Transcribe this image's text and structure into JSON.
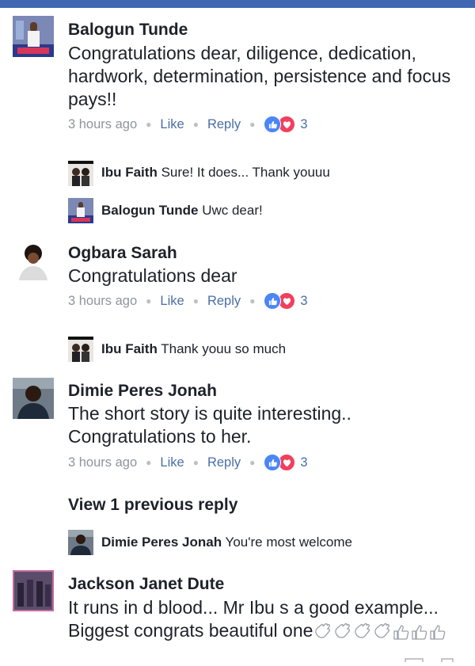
{
  "comments": [
    {
      "author": "Balogun Tunde",
      "text": "Congratulations dear, diligence, dedication, hardwork, determination, persistence and focus pays!!",
      "time": "3 hours ago",
      "like_label": "Like",
      "reply_label": "Reply",
      "reaction_count": "3",
      "avatar_icon": "avatar-photo-icon",
      "replies": [
        {
          "author": "Ibu Faith",
          "text": "Sure! It does... Thank youuu"
        },
        {
          "author": "Balogun Tunde",
          "text": "Uwc dear!"
        }
      ]
    },
    {
      "author": "Ogbara Sarah",
      "text": "Congratulations dear",
      "time": "3 hours ago",
      "like_label": "Like",
      "reply_label": "Reply",
      "reaction_count": "3",
      "avatar_icon": "avatar-photo-icon",
      "replies": [
        {
          "author": "Ibu Faith",
          "text": "Thank youu so much"
        }
      ]
    },
    {
      "author": "Dimie Peres Jonah",
      "text": "The short story is quite interesting.. Congratulations to her.",
      "time": "3 hours ago",
      "like_label": "Like",
      "reply_label": "Reply",
      "reaction_count": "3",
      "avatar_icon": "avatar-photo-icon",
      "view_previous": "View 1 previous reply",
      "replies": [
        {
          "author": "Dimie Peres Jonah",
          "text": "You're most welcome"
        }
      ]
    },
    {
      "author": "Jackson Janet Dute",
      "text_line1": "It runs in d blood... Mr Ibu s a good example...",
      "text_line2": "Biggest congrats beautiful one",
      "emoji": [
        "clapping-hands-icon",
        "clapping-hands-icon",
        "clapping-hands-icon",
        "clapping-hands-icon",
        "thumbs-up-icon",
        "thumbs-up-icon",
        "thumbs-up-icon"
      ],
      "avatar_icon": "avatar-photo-icon"
    }
  ],
  "colors": {
    "brand": "#4267b2",
    "link": "#4b6ea8",
    "meta": "#90949c",
    "like": "#4b86f7",
    "love": "#f0405e"
  }
}
